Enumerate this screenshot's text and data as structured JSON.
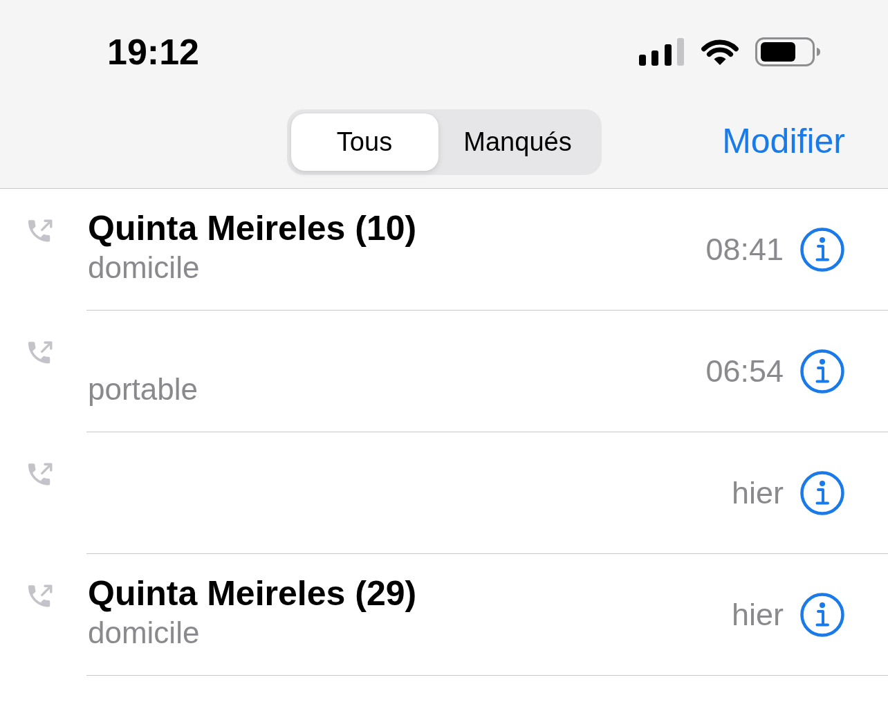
{
  "status_bar": {
    "time": "19:12"
  },
  "nav": {
    "tabs": [
      {
        "label": "Tous",
        "selected": true
      },
      {
        "label": "Manqués",
        "selected": false
      }
    ],
    "edit_button": "Modifier"
  },
  "calls": [
    {
      "name": "Quinta Meireles (10)",
      "label": "domicile",
      "time": "08:41"
    },
    {
      "label": "portable",
      "time": "06:54"
    },
    {
      "time": "hier"
    },
    {
      "name": "Quinta Meireles (29)",
      "label": "domicile",
      "time": "hier"
    }
  ]
}
